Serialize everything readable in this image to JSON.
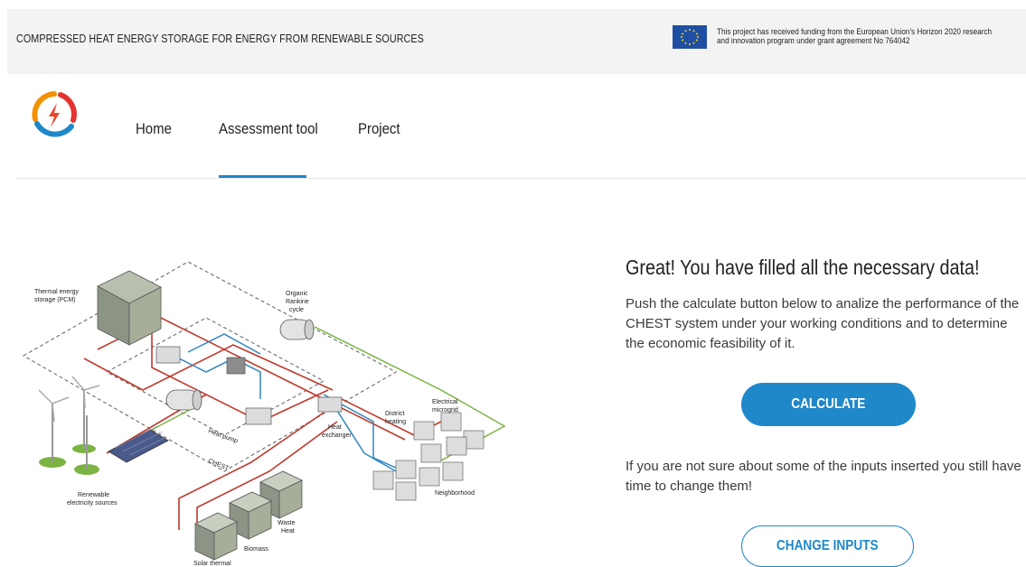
{
  "topbar": {
    "title": "COMPRESSED HEAT ENERGY STORAGE FOR ENERGY FROM RENEWABLE SOURCES",
    "funding_text": "This project has received funding from the European Union's Horizon 2020 research and innovation program under grant agreement No 764042",
    "eu_flag_icon": "eu-flag-icon"
  },
  "nav": {
    "logo_icon": "lightning-circle-logo",
    "items": [
      {
        "label": "Home"
      },
      {
        "label": "Assessment tool",
        "active": true
      },
      {
        "label": "Project"
      }
    ]
  },
  "diagram": {
    "labels": {
      "thermal_storage": [
        "Thermal energy",
        "storage (PCM)"
      ],
      "orc": [
        "Organic",
        "Rankine",
        "cycle"
      ],
      "heat_pump": "Heat pump",
      "chest": "CHEST",
      "heat_exchanger": [
        "Heat",
        "exchanger"
      ],
      "district_heating": [
        "District",
        "heating"
      ],
      "microgrid": [
        "Electrical",
        "microgrid"
      ],
      "neighborhood": "Neighborhood",
      "renewable": [
        "Renewable",
        "electricity  sources"
      ],
      "waste_heat": [
        "Waste",
        "Heat"
      ],
      "biomass": "Biomass",
      "solar_thermal": "Solar thermal"
    }
  },
  "main": {
    "heading": "Great! You have filled all the necessary data!",
    "description": "Push the calculate button below to analize the performance of the CHEST system under your working conditions and to determine the economic feasibility of it.",
    "calculate_label": "CALCULATE",
    "change_note": "If you are not sure about some of the inputs inserted you still have time to change them!",
    "change_label": "CHANGE INPUTS"
  },
  "colors": {
    "accent": "#1f88c9",
    "topbar_bg": "#f3f3f3",
    "hot_line": "#c0392b",
    "cold_line": "#2e86c1",
    "electric_line": "#7cb342"
  }
}
